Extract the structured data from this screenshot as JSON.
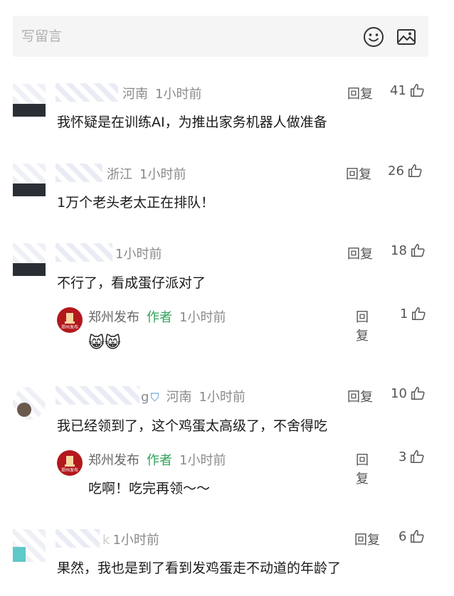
{
  "compose": {
    "placeholder": "写留言"
  },
  "comments": [
    {
      "location": "河南",
      "time": "1小时前",
      "text": "我怀疑是在训练AI，为推出家务机器人做准备",
      "likes": "41"
    },
    {
      "location": "浙江",
      "time": "1小时前",
      "text": "1万个老头老太正在排队！",
      "likes": "26"
    },
    {
      "time": "1小时前",
      "text": "不行了，看成蛋仔派对了",
      "likes": "18",
      "reply": {
        "author": "郑州发布",
        "tag": "作者",
        "time": "1小时前",
        "likes": "1",
        "emoji": "😸😸"
      }
    },
    {
      "name_suffix": "g",
      "location": "河南",
      "time": "1小时前",
      "text": "我已经领到了，这个鸡蛋太高级了，不舍得吃",
      "likes": "10",
      "reply": {
        "author": "郑州发布",
        "tag": "作者",
        "time": "1小时前",
        "likes": "3",
        "text": "吃啊！吃完再领～～"
      }
    },
    {
      "name_suffix": "k",
      "time": "1小时前",
      "text": "果然，我也是到了看到发鸡蛋走不动道的年龄了",
      "likes": "6"
    }
  ],
  "reply_label": "回复",
  "avatar_text": "郑州发布"
}
